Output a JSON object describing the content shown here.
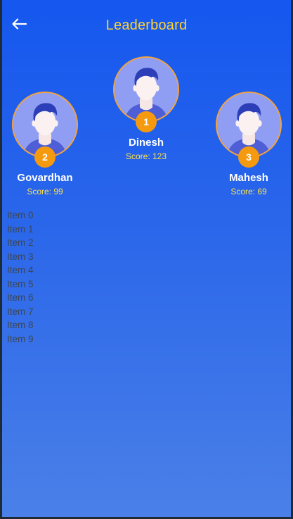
{
  "header": {
    "title": "Leaderboard",
    "back_icon": "arrow-left-icon"
  },
  "colors": {
    "gradient_top": "#1557ef",
    "gradient_bottom": "#4a80e8",
    "title": "#ffd430",
    "badge": "#f59a0f",
    "score": "#ffe24a",
    "avatar_border": "#f3a33f"
  },
  "podium": {
    "first": {
      "rank": "1",
      "name": "Dinesh",
      "score": "Score: 123"
    },
    "second": {
      "rank": "2",
      "name": "Govardhan",
      "score": "Score: 99"
    },
    "third": {
      "rank": "3",
      "name": "Mahesh",
      "score": "Score: 69"
    }
  },
  "list": {
    "items": [
      "Item 0",
      "Item 1",
      "Item 2",
      "Item 3",
      "Item 4",
      "Item 5",
      "Item 6",
      "Item 7",
      "Item 8",
      "Item 9"
    ]
  }
}
